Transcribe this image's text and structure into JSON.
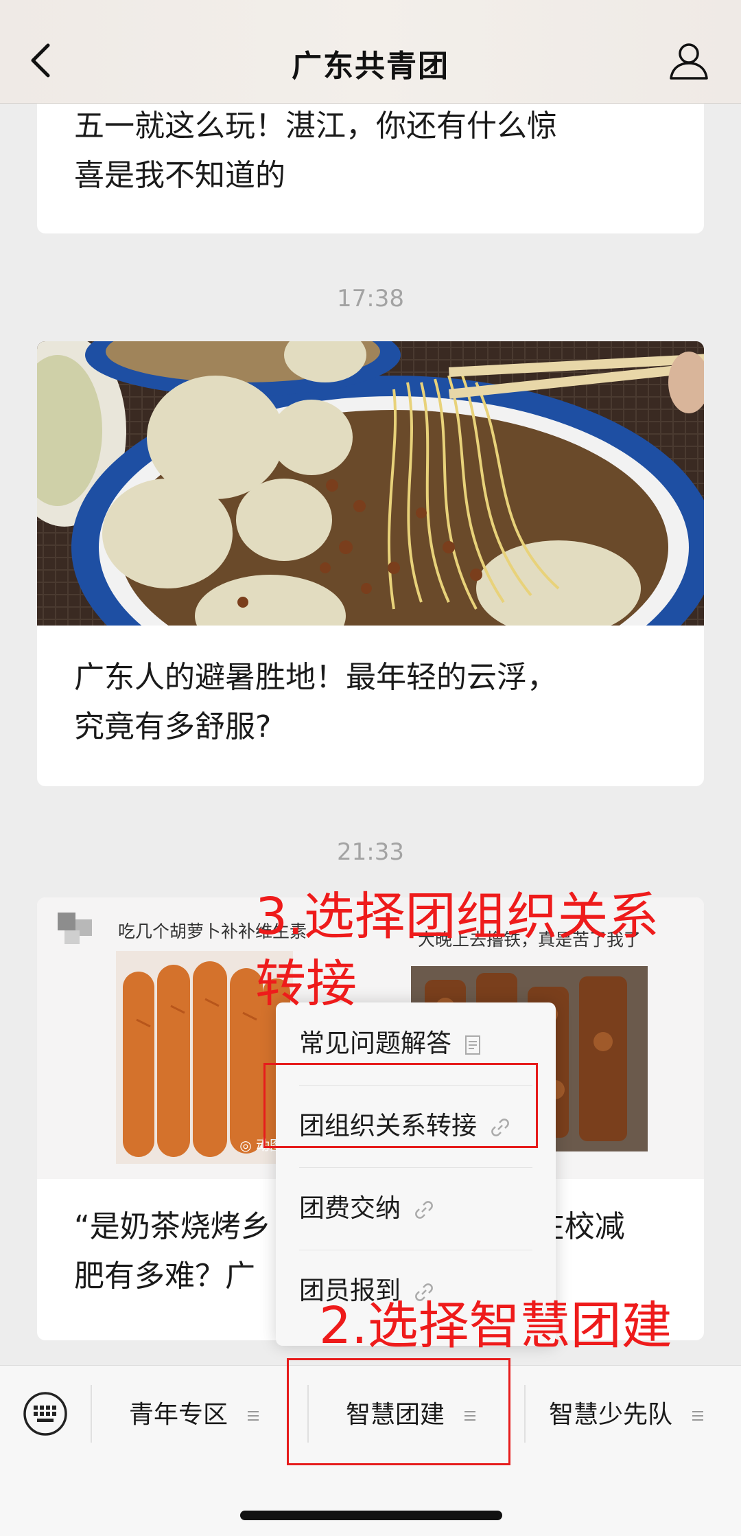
{
  "nav": {
    "title": "广东共青团"
  },
  "feed": {
    "article1_title_lines": [
      "五一就这么玩！湛江，你还有什么惊",
      "喜是我不知道的"
    ],
    "time1": "17:38",
    "article2_title_lines": [
      "广东人的避暑胜地！最年轻的云浮，",
      "究竟有多舒服?"
    ],
    "time2": "21:33",
    "article3": {
      "cover_left_caption": "吃几个胡萝卜补补维生素",
      "cover_right_caption": "大晚上去撸铁，真是苦了我了",
      "gif_label": "◎ 动图",
      "title_line1_a": "“是奶茶烧烤乡",
      "title_line1_b": "在校减",
      "title_line2_a": "肥有多难？广",
      "title_line2_b": ""
    }
  },
  "popup_menu": {
    "items": [
      {
        "label": "常见问题解答",
        "icon": "document-icon"
      },
      {
        "label": "团组织关系转接",
        "icon": "link-icon"
      },
      {
        "label": "团费交纳",
        "icon": "link-icon"
      },
      {
        "label": "团员报到",
        "icon": "link-icon"
      }
    ]
  },
  "annotations": {
    "step3_line1": "3.选择团组织关系",
    "step3_line2": "转接",
    "step2": "2.选择智慧团建",
    "color": "#ee1b1b"
  },
  "bottom_menu": {
    "tabs": [
      "青年专区",
      "智慧团建",
      "智慧少先队"
    ]
  }
}
